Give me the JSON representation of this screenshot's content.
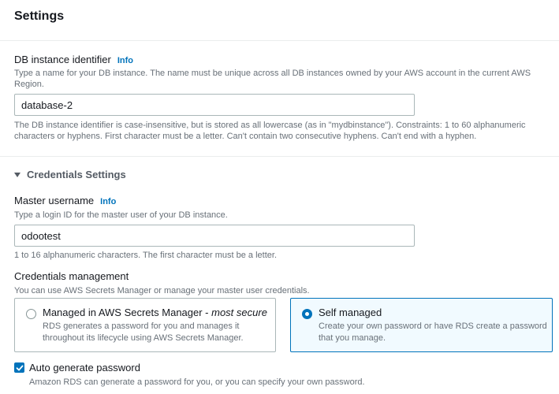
{
  "settings": {
    "title": "Settings"
  },
  "db_identifier": {
    "label": "DB instance identifier",
    "info": "Info",
    "description": "Type a name for your DB instance. The name must be unique across all DB instances owned by your AWS account in the current AWS Region.",
    "value": "database-2",
    "constraint": "The DB instance identifier is case-insensitive, but is stored as all lowercase (as in \"mydbinstance\"). Constraints: 1 to 60 alphanumeric characters or hyphens. First character must be a letter. Can't contain two consecutive hyphens. Can't end with a hyphen."
  },
  "credentials": {
    "section_title": "Credentials Settings",
    "master_username": {
      "label": "Master username",
      "info": "Info",
      "description": "Type a login ID for the master user of your DB instance.",
      "value": "odootest",
      "constraint": "1 to 16 alphanumeric characters. The first character must be a letter."
    },
    "management": {
      "label": "Credentials management",
      "description": "You can use AWS Secrets Manager or manage your master user credentials.",
      "options": [
        {
          "title": "Managed in AWS Secrets Manager - ",
          "title_emphasis": "most secure",
          "description": "RDS generates a password for you and manages it throughout its lifecycle using AWS Secrets Manager.",
          "selected": false
        },
        {
          "title": "Self managed",
          "title_emphasis": "",
          "description": "Create your own password or have RDS create a password that you manage.",
          "selected": true
        }
      ]
    },
    "auto_generate": {
      "label": "Auto generate password",
      "description": "Amazon RDS can generate a password for you, or you can specify your own password.",
      "checked": true
    }
  },
  "colors": {
    "accent": "#0073bb",
    "text": "#16191f",
    "muted": "#687078",
    "border": "#aab7b8"
  }
}
